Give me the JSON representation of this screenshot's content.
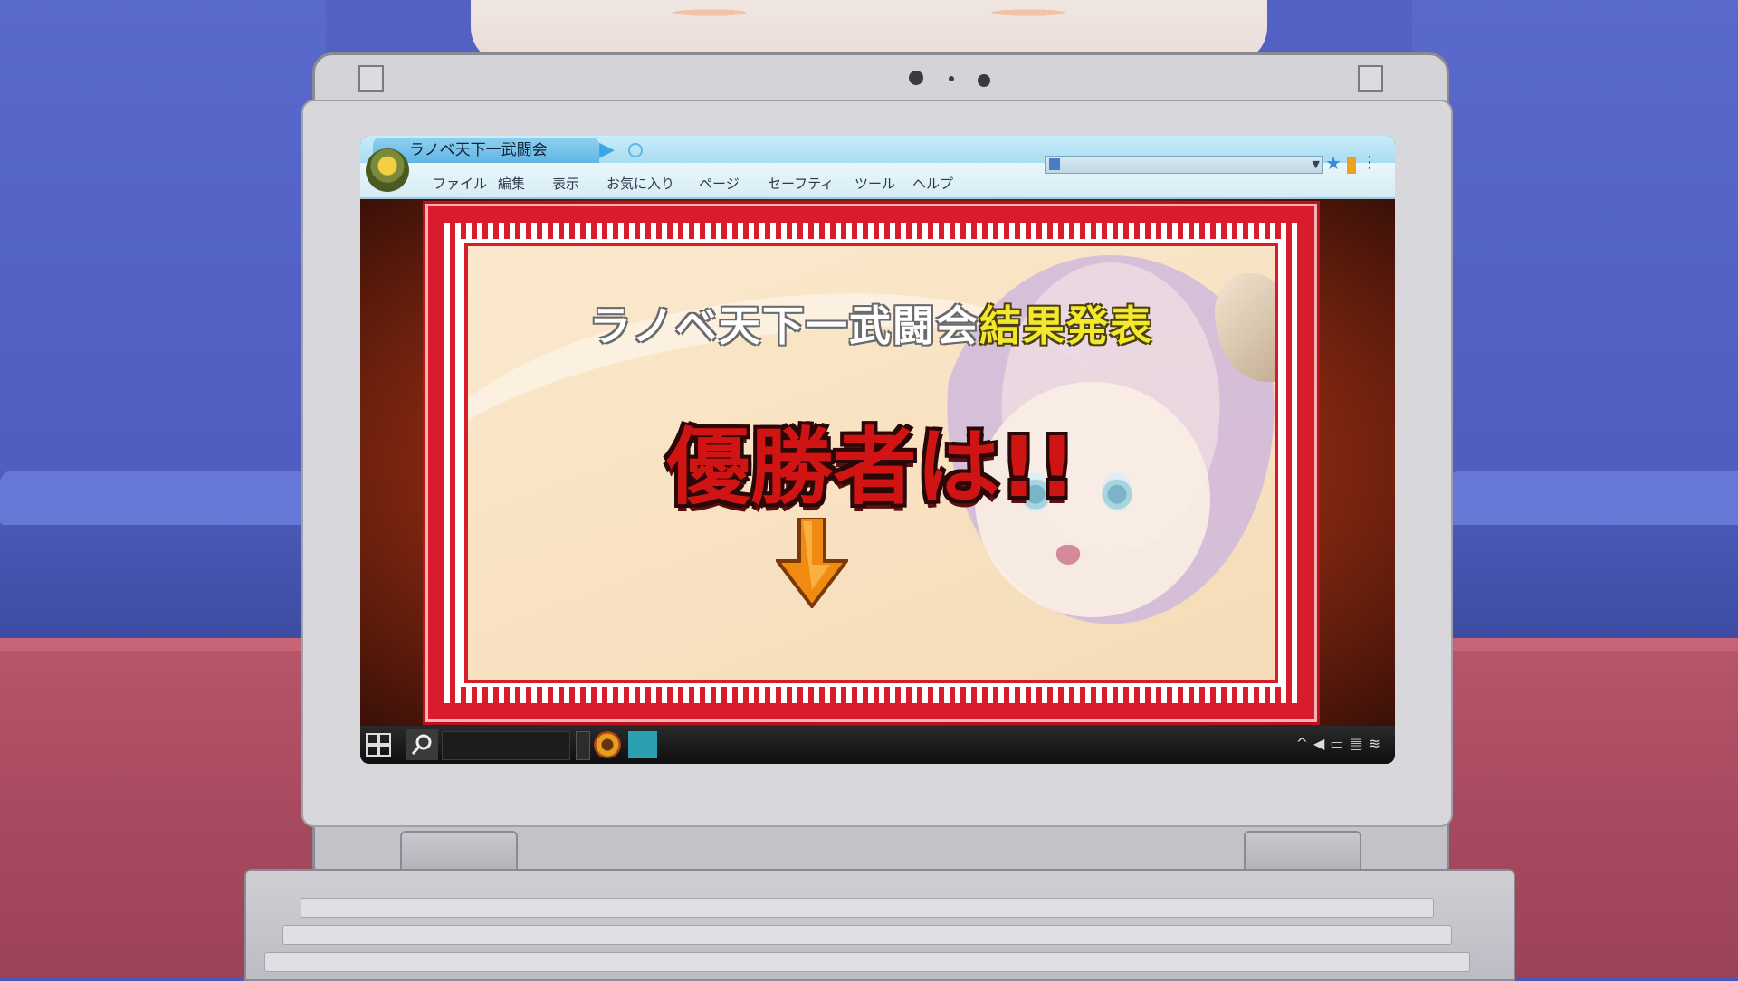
{
  "browser": {
    "tab_title": "ラノベ天下一武闘会",
    "menu": [
      "ファイル",
      "編集",
      "表示",
      "お気に入り",
      "ページ",
      "セーフティ",
      "ツール",
      "ヘルプ"
    ]
  },
  "page": {
    "headline_main": "ラノベ天下一武闘会",
    "headline_highlight": "結果発表",
    "winner_text": "優勝者は!!"
  },
  "colors": {
    "frame_red": "#d81c2c",
    "headline_highlight": "#f4e82c",
    "winner_red": "#d01414",
    "arrow_orange": "#f08a10"
  },
  "icons": {
    "start": "windows-start-icon",
    "search": "magnifier-icon",
    "favorite": "star-icon"
  }
}
